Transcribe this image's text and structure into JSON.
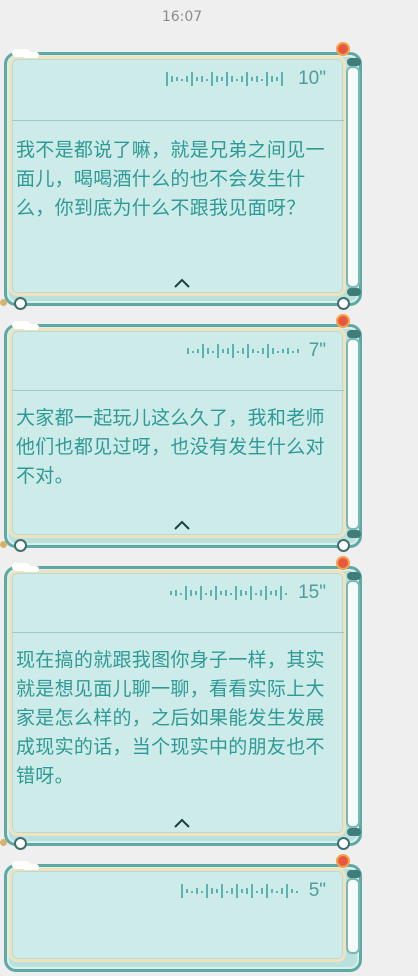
{
  "status_bar": {
    "time": "16:07"
  },
  "messages": [
    {
      "duration": "10\"",
      "text": "我不是都说了嘛，就是兄弟之间见一面儿，喝喝酒什么的也不会发生什么，你到底为什么不跟我见面呀？"
    },
    {
      "duration": "7\"",
      "text": "大家都一起玩儿这么久了，我和老师他们也都见过呀，也没有发生什么对不对。"
    },
    {
      "duration": "15\"",
      "text": "现在搞的就跟我图你身子一样，其实就是想见面儿聊一聊，看看实际上大家是怎么样的，之后如果能发生发展成现实的话，当个现实中的朋友也不错呀。"
    },
    {
      "duration": "5\"",
      "text": ""
    }
  ],
  "theme": {
    "accent": "#2f9a95",
    "frame": "#5fa9a4",
    "panel": "#cdebe9"
  }
}
